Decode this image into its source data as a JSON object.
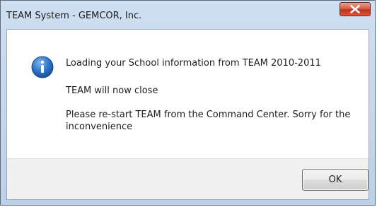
{
  "window": {
    "title": "TEAM System - GEMCOR, Inc.",
    "close_icon": "close-icon"
  },
  "message": {
    "icon": "info-icon",
    "line1": "Loading your School information from TEAM 2010-2011",
    "line2": "TEAM will now close",
    "line3": "Please re-start TEAM from the Command Center.  Sorry for the inconvenience"
  },
  "buttons": {
    "ok_label": "OK"
  }
}
